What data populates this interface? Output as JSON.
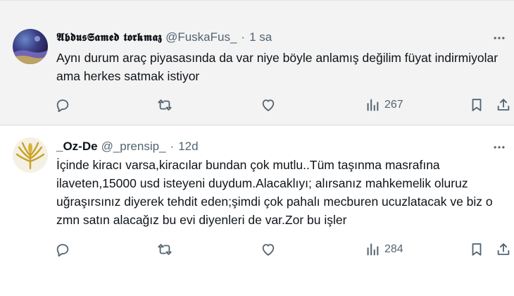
{
  "tweets": [
    {
      "display_name": "𝕬𝖇𝖉𝖚𝖘𝕾𝖆𝖒𝖊𝖉 𝖙𝖔𝖗𝖐𝖒𝖆𝖟",
      "handle": "@FuskaFus_",
      "dot": "·",
      "time": "1 sa",
      "text": "Aynı durum araç piyasasında da var niye böyle anlamış değilim füyat indirmiyolar ama herkes satmak istiyor",
      "views": "267"
    },
    {
      "display_name": "_Oz-De",
      "handle": "@_prensip_",
      "dot": "·",
      "time": "12d",
      "text": "İçinde kiracı varsa,kiracılar bundan çok mutlu..Tüm taşınma masrafına ilaveten,15000 usd isteyeni duydum.Alacaklıyı; alırsanız mahkemelik oluruz uğraşırsınız diyerek tehdit eden;şimdi çok pahalı mecburen ucuzlatacak ve biz o zmn satın alacağız bu evi diyenleri de var.Zor bu işler",
      "views": "284"
    }
  ],
  "icons": {
    "more": "more-horizontal-icon",
    "reply": "reply-icon",
    "retweet": "retweet-icon",
    "like": "heart-icon",
    "views": "views-chart-icon",
    "bookmark": "bookmark-icon",
    "share": "share-icon"
  },
  "colors": {
    "text": "#0f1419",
    "secondary": "#536471",
    "highlight_bg": "#f3f3f3"
  }
}
